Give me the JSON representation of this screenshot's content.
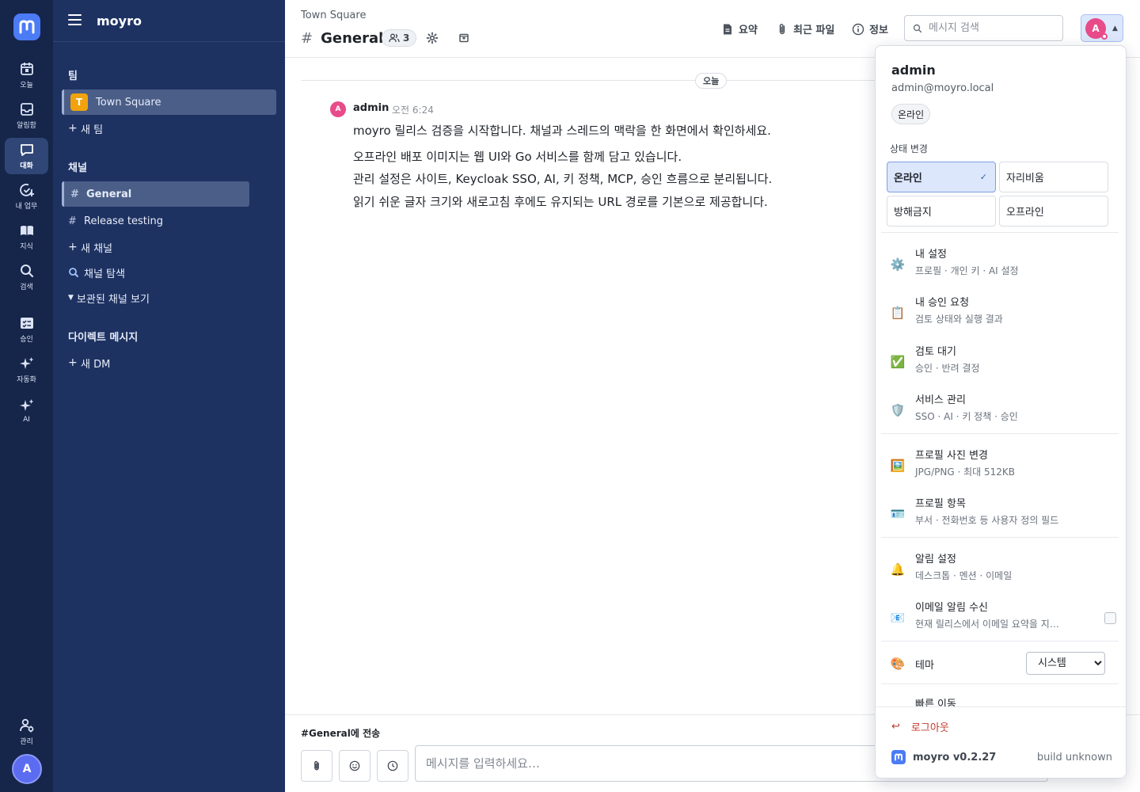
{
  "rail": {
    "items": [
      {
        "label": "오늘",
        "icon": "calendar-icon"
      },
      {
        "label": "알림함",
        "icon": "inbox-icon"
      },
      {
        "label": "대화",
        "icon": "chat-icon"
      },
      {
        "label": "내 업무",
        "icon": "task-check-icon"
      },
      {
        "label": "지식",
        "icon": "book-icon"
      },
      {
        "label": "검색",
        "icon": "search-icon"
      },
      {
        "label": "승인",
        "icon": "approval-icon"
      },
      {
        "label": "자동화",
        "icon": "sparkle-icon"
      },
      {
        "label": "AI",
        "icon": "ai-sparkle-icon"
      },
      {
        "label": "관리",
        "icon": "admin-users-icon"
      }
    ],
    "avatar_initial": "A"
  },
  "sidebar": {
    "title": "moyro",
    "team_section": "팀",
    "team_badge": "T",
    "team_name": "Town Square",
    "new_team": "새 팀",
    "channels_section": "채널",
    "channels": [
      "General",
      "Release testing"
    ],
    "new_channel": "새 채널",
    "browse_channels": "채널 탐색",
    "archived_channels": "보관된 채널 보기",
    "dm_section": "다이렉트 메시지",
    "new_dm": "새 DM"
  },
  "header": {
    "breadcrumb": "Town Square",
    "channel_name": "General",
    "member_count": "3",
    "summary": "요약",
    "recent_files": "최근 파일",
    "info": "정보",
    "search_placeholder": "메시지 검색",
    "avatar_initial": "A"
  },
  "messages": {
    "date_label": "오늘",
    "author_initial": "A",
    "author": "admin",
    "time": "오전 6:24",
    "lines": [
      "moyro 릴리스 검증을 시작합니다. 채널과 스레드의 맥락을 한 화면에서 확인하세요.",
      "오프라인 배포 이미지는 웹 UI와 Go 서비스를 함께 담고 있습니다.",
      "관리 설정은 사이트, Keycloak SSO, AI, 키 정책, MCP, 승인 흐름으로 분리됩니다.",
      "읽기 쉬운 글자 크기와 새로고침 후에도 유지되는 URL 경로를 기본으로 제공합니다."
    ]
  },
  "composer": {
    "send_to": "#General에 전송",
    "placeholder": "메시지를 입력하세요…"
  },
  "menu": {
    "name": "admin",
    "email": "admin@moyro.local",
    "status": "온라인",
    "status_section": "상태 변경",
    "status_options": [
      "온라인",
      "자리비움",
      "방해금지",
      "오프라인"
    ],
    "selected_mark": "✓",
    "items": [
      {
        "icon": "⚙️",
        "title": "내 설정",
        "sub": "프로필 · 개인 키 · AI 설정"
      },
      {
        "icon": "📋",
        "title": "내 승인 요청",
        "sub": "검토 상태와 실행 결과"
      },
      {
        "icon": "✅",
        "title": "검토 대기",
        "sub": "승인 · 반려 결정"
      },
      {
        "icon": "🛡️",
        "title": "서비스 관리",
        "sub": "SSO · AI · 키 정책 · 승인"
      },
      {
        "icon": "🖼️",
        "title": "프로필 사진 변경",
        "sub": "JPG/PNG · 최대 512KB"
      },
      {
        "icon": "🪪",
        "title": "프로필 항목",
        "sub": "부서 · 전화번호 등 사용자 정의 필드"
      },
      {
        "icon": "🔔",
        "title": "알림 설정",
        "sub": "데스크톱 · 멘션 · 이메일"
      },
      {
        "icon": "📧",
        "title": "이메일 알림 수신",
        "sub": "현재 릴리스에서 이메일 요약을 지…"
      }
    ],
    "theme_icon": "🎨",
    "theme_label": "테마",
    "theme_value": "시스템",
    "quick_nav": "빠른 이동",
    "logout_icon": "↩",
    "logout": "로그아웃",
    "version": "moyro v0.2.27",
    "build": "build unknown"
  }
}
